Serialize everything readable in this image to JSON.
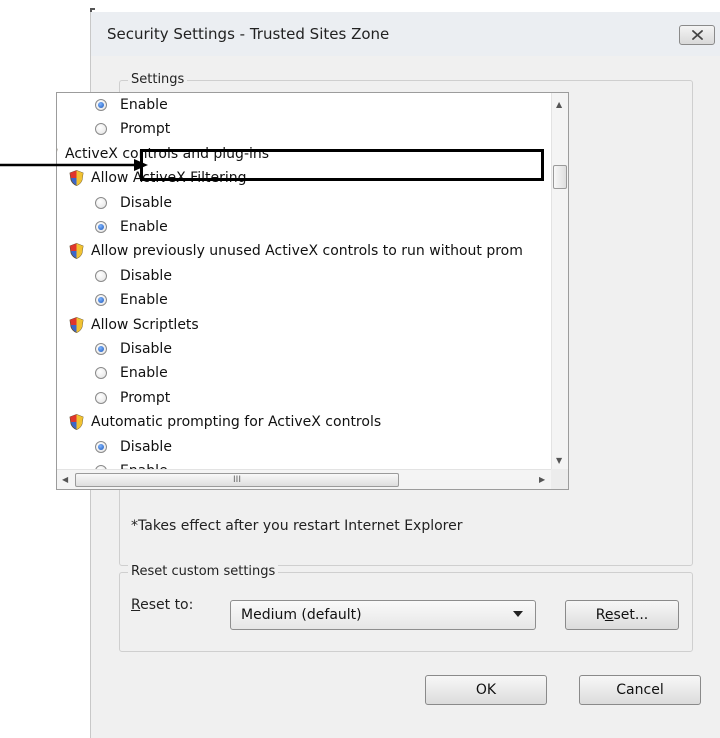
{
  "dialog": {
    "title": "Security Settings - Trusted Sites Zone",
    "close_icon": "close-icon"
  },
  "settings_group": {
    "legend": "Settings",
    "rows": [
      {
        "kind": "radio",
        "checked": true,
        "label": "Enable",
        "indent": 1
      },
      {
        "kind": "radio",
        "checked": false,
        "label": "Prompt",
        "indent": 1
      },
      {
        "kind": "category",
        "label": "ActiveX controls and plug-ins",
        "icon": "shield-icon",
        "indent": 0
      },
      {
        "kind": "setting",
        "label": "Allow ActiveX Filtering",
        "icon": "shield-icon",
        "indent": 1
      },
      {
        "kind": "radio",
        "checked": false,
        "label": "Disable",
        "indent": 1
      },
      {
        "kind": "radio",
        "checked": true,
        "label": "Enable",
        "indent": 1
      },
      {
        "kind": "setting",
        "label": "Allow previously unused ActiveX controls to run without prom",
        "icon": "shield-icon",
        "indent": 1
      },
      {
        "kind": "radio",
        "checked": false,
        "label": "Disable",
        "indent": 1
      },
      {
        "kind": "radio",
        "checked": true,
        "label": "Enable",
        "indent": 1
      },
      {
        "kind": "setting",
        "label": "Allow Scriptlets",
        "icon": "shield-icon",
        "indent": 1
      },
      {
        "kind": "radio",
        "checked": true,
        "label": "Disable",
        "indent": 1
      },
      {
        "kind": "radio",
        "checked": false,
        "label": "Enable",
        "indent": 1
      },
      {
        "kind": "radio",
        "checked": false,
        "label": "Prompt",
        "indent": 1
      },
      {
        "kind": "setting",
        "label": "Automatic prompting for ActiveX controls",
        "icon": "shield-icon",
        "indent": 1
      },
      {
        "kind": "radio",
        "checked": true,
        "label": "Disable",
        "indent": 1
      },
      {
        "kind": "radio",
        "checked": false,
        "label": "Enable",
        "indent": 1
      }
    ],
    "hscroll_grip": "III",
    "note": "*Takes effect after you restart Internet Explorer"
  },
  "reset_group": {
    "legend": "Reset custom settings",
    "reset_to_label": "Reset to:",
    "reset_to_value": "Medium (default)",
    "reset_button": "Reset..."
  },
  "footer": {
    "ok_label": "OK",
    "cancel_label": "Cancel"
  },
  "annotation": {
    "highlight_color": "#000000"
  },
  "colors": {
    "radio_checked": "#1b56b8",
    "dialog_bg": "#f0f0f0"
  }
}
